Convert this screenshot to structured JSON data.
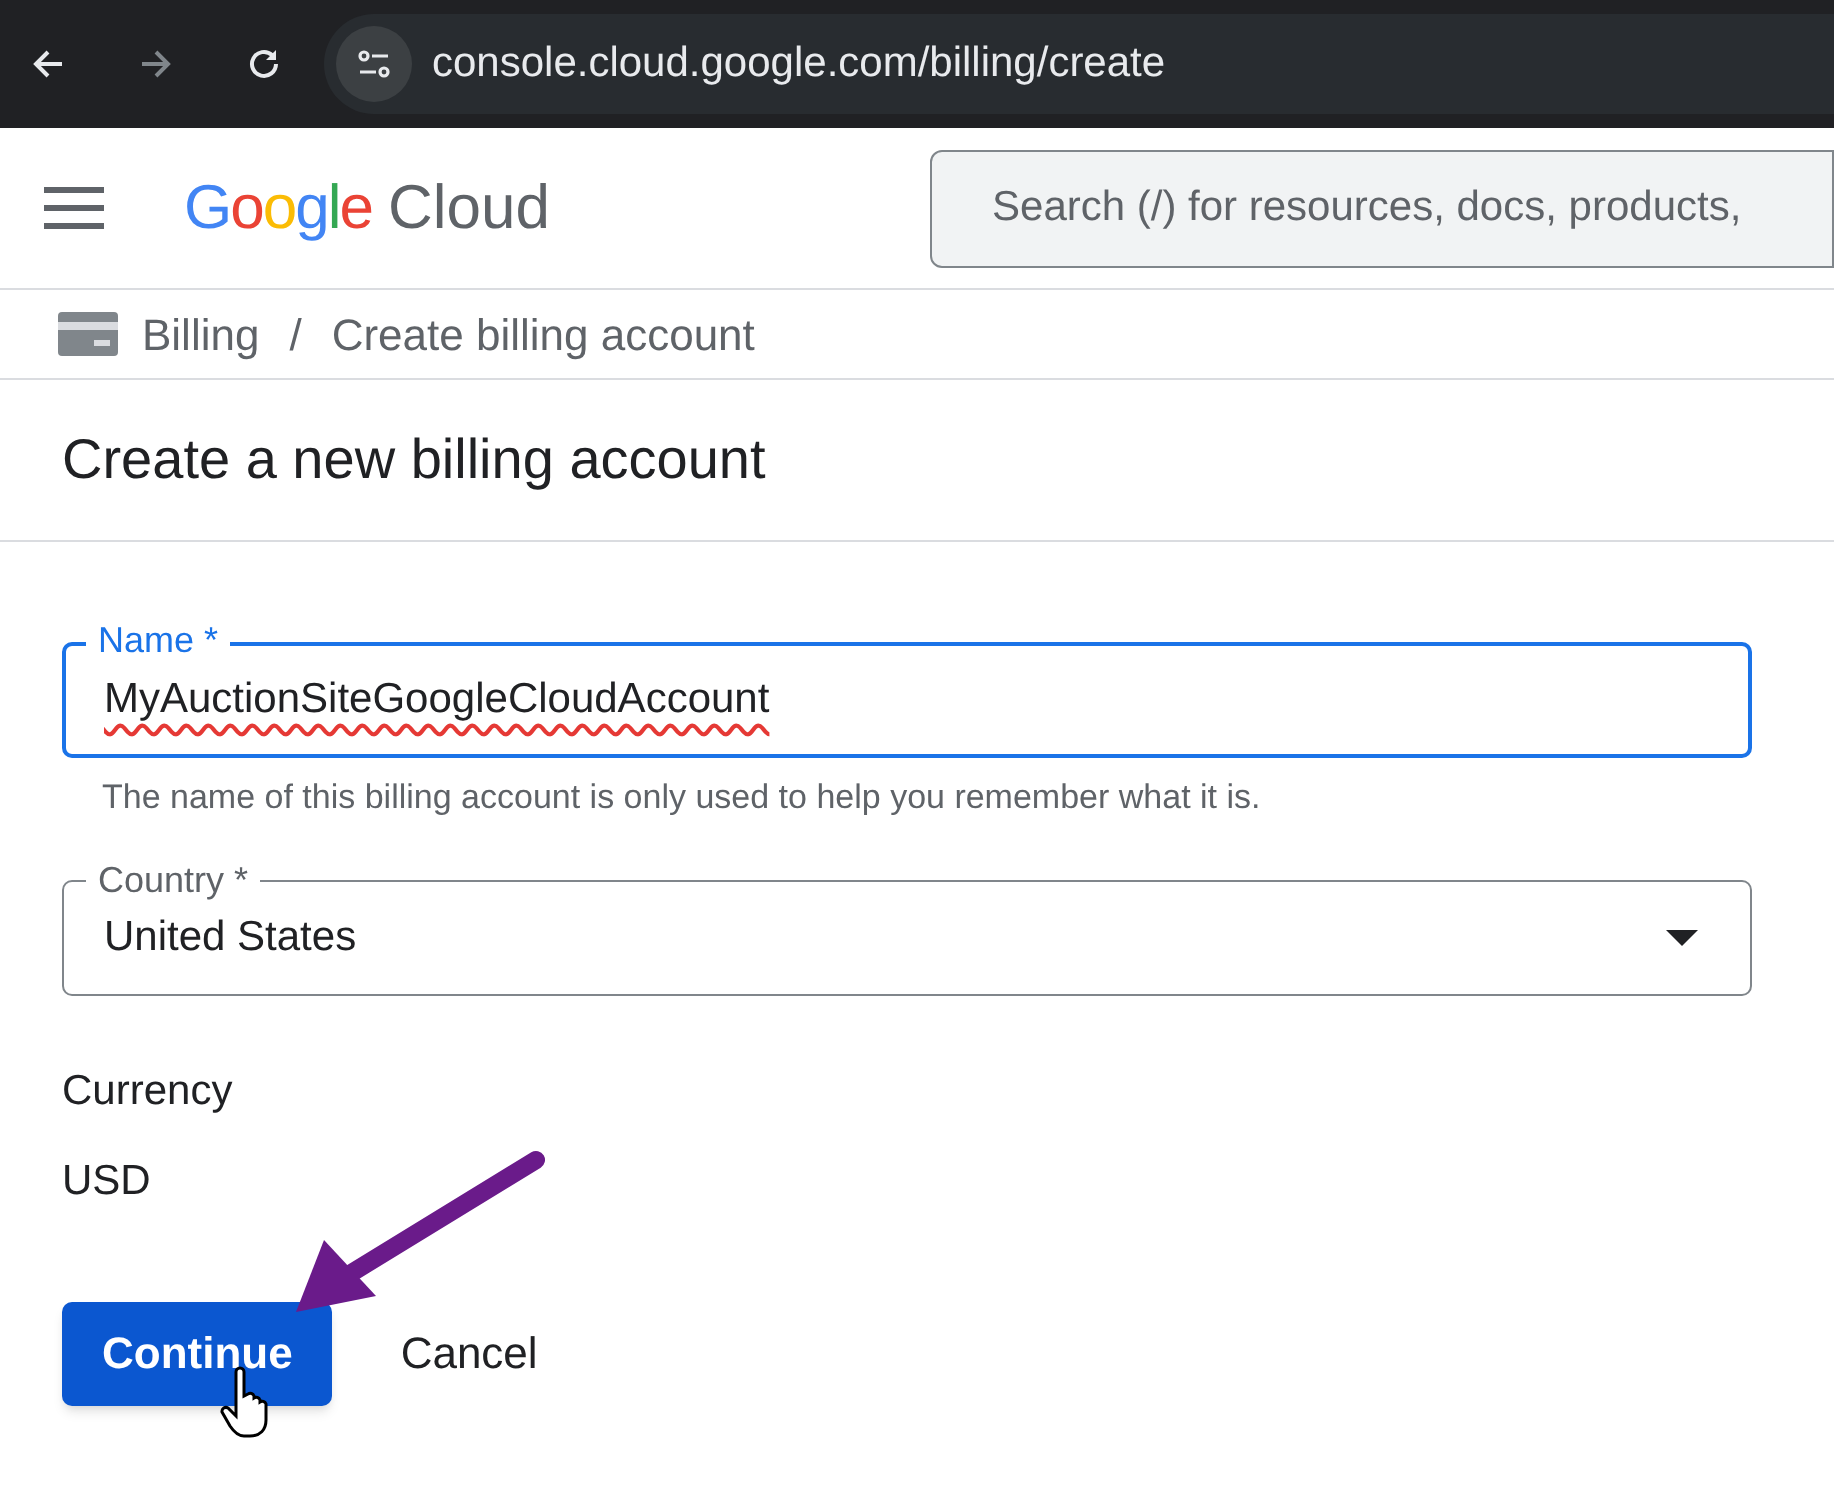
{
  "browser": {
    "url": "console.cloud.google.com/billing/create"
  },
  "header": {
    "logo_brand": "Google",
    "logo_product": "Cloud",
    "search": {
      "placeholder": "Search (/) for resources, docs, products,"
    }
  },
  "breadcrumb": [
    "Billing",
    "/",
    "Create billing account"
  ],
  "title": "Create a new billing account",
  "fields": [
    {
      "kind": "text",
      "label": "Name *",
      "value": "MyAuctionSiteGoogleCloudAccount",
      "focused": true,
      "misspelled": true,
      "helper": "The name of this billing account is only used to help you remember what it is."
    },
    {
      "kind": "select",
      "label": "Country *",
      "value": "United States",
      "focused": false
    }
  ],
  "currency": {
    "label": "Currency",
    "value": "USD"
  },
  "buttons": [
    {
      "label": "Continue",
      "kind": "primary"
    },
    {
      "label": "Cancel",
      "kind": "text"
    }
  ]
}
